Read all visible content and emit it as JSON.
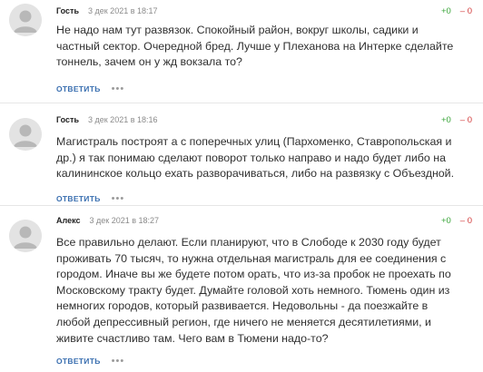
{
  "comments": [
    {
      "author": "Гость",
      "date": "3 дек 2021 в 18:17",
      "plus": "+0",
      "minus": "– 0",
      "text": "Не надо нам тут развязок. Спокойный район, вокруг школы, садики и\nчастный сектор. Очередной бред. Лучше у Плеханова на Интерке сделайте\nтоннель, зачем он у жд вокзала то?",
      "reply": "ОТВЕТИТЬ",
      "more": "•••",
      "avatar_icon": "user-avatar-icon"
    },
    {
      "author": "Гость",
      "date": "3 дек 2021 в 18:16",
      "plus": "+0",
      "minus": "– 0",
      "text": "Магистраль построят а с поперечных улиц (Пархоменко, Ставропольская и\nдр.) я так понимаю сделают поворот только направо и надо будет либо на\nкалининское кольцо ехать разворачиваться, либо на развязку с Объездной.",
      "reply": "ОТВЕТИТЬ",
      "more": "•••",
      "avatar_icon": "user-avatar-icon"
    },
    {
      "author": "Алекс",
      "date": "3 дек 2021 в 18:27",
      "plus": "+0",
      "minus": "– 0",
      "text": "Все правильно делают. Если планируют, что в Слободе к 2030 году будет\nпроживать 70 тысяч, то нужна отдельная магистраль для ее соединения с\nгородом. Иначе вы же будете потом орать, что из-за пробок не проехать по\nМосковскому тракту будет. Думайте головой хоть немного. Тюмень один из\nнемногих городов, который развивается. Недовольны - да поезжайте в\nлюбой депрессивный регион, где ничего не меняется десятилетиями, и\nживите счастливо там. Чего вам в Тюмени надо-то?",
      "reply": "ОТВЕТИТЬ",
      "more": "•••",
      "avatar_icon": "user-avatar-icon"
    }
  ],
  "colors": {
    "plus": "#3aa53a",
    "minus": "#d23a3a",
    "reply": "#3a6fb0",
    "avatar_bg": "#e3e3e3",
    "avatar_fg": "#b8b8b8"
  }
}
